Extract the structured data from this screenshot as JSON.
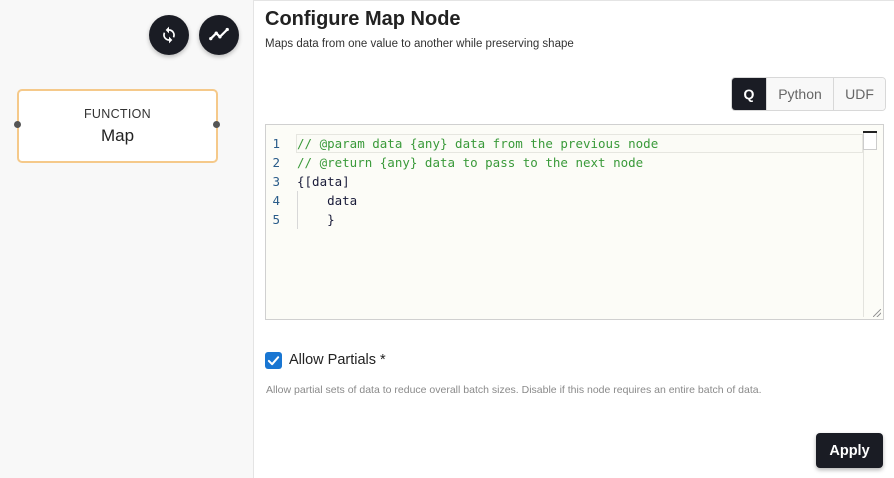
{
  "canvas": {
    "node": {
      "type_label": "FUNCTION",
      "name": "Map"
    },
    "buttons": [
      {
        "icon": "refresh-icon"
      },
      {
        "icon": "line-chart-icon"
      }
    ]
  },
  "panel": {
    "title": "Configure Map Node",
    "subtitle": "Maps data from one value to another while preserving shape",
    "languages": [
      "Q",
      "Python",
      "UDF"
    ],
    "active_language": "Q",
    "editor": {
      "lines": [
        {
          "no": "1",
          "text": "// @param data {any} data from the previous node",
          "kind": "comment"
        },
        {
          "no": "2",
          "text": "// @return {any} data to pass to the next node",
          "kind": "comment"
        },
        {
          "no": "3",
          "text": "{[data]",
          "kind": "plain"
        },
        {
          "no": "4",
          "text": "    data",
          "kind": "plain"
        },
        {
          "no": "5",
          "text": "    }",
          "kind": "plain"
        }
      ]
    },
    "allow_partials": {
      "label": "Allow Partials *",
      "checked": true,
      "help": "Allow partial sets of data to reduce overall batch sizes. Disable if this node requires an entire batch of data."
    },
    "apply_label": "Apply"
  },
  "colors": {
    "accent_dark": "#1a1c24",
    "node_border": "#f5c98a",
    "checkbox": "#1976d2",
    "comment": "#3a9a3a"
  }
}
